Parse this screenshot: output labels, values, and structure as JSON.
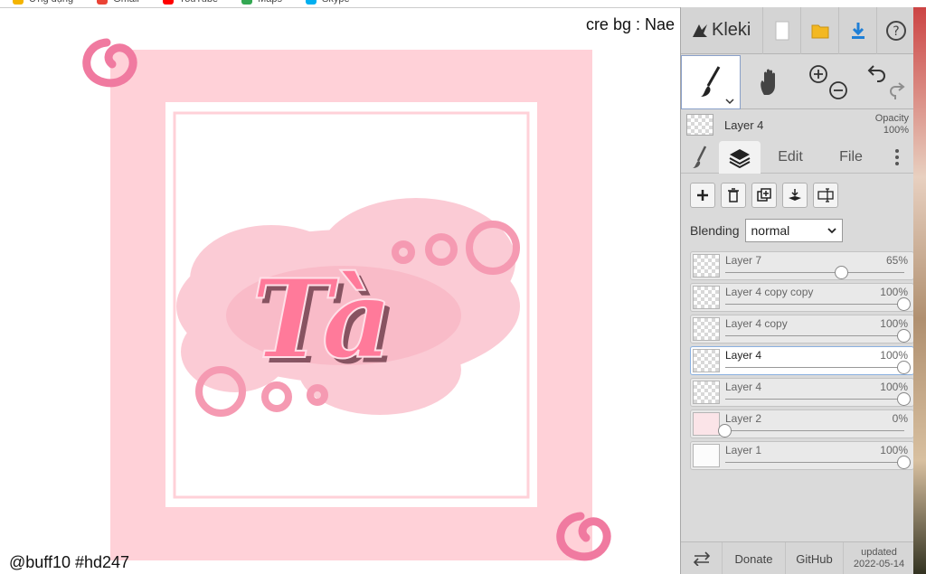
{
  "bookmarks": [
    {
      "label": "Ứng dụng",
      "color": "#f4b400"
    },
    {
      "label": "Gmail",
      "color": "#ea4335"
    },
    {
      "label": "YouTube",
      "color": "#ff0000"
    },
    {
      "label": "Maps",
      "color": "#34a853"
    },
    {
      "label": "Skype",
      "color": "#00aff0"
    }
  ],
  "canvas": {
    "credit_top": "cre bg : Nae",
    "credit_bottom": "@buff10 #hd247",
    "artwork_text": "Tà",
    "colors": {
      "frame": "#ffd1d8",
      "accent": "#ff6f93",
      "swirl": "#f07aa0",
      "bubble": "#f59ab2"
    }
  },
  "app": {
    "name": "Kleki"
  },
  "top_buttons": {
    "new": "new-image-icon",
    "open": "folder-icon",
    "save": "download-icon",
    "help": "help-icon"
  },
  "preview": {
    "layer_name": "Layer 4",
    "opacity_label": "Opacity",
    "opacity_value": "100%"
  },
  "tabs": {
    "edit": "Edit",
    "file": "File"
  },
  "blending": {
    "label": "Blending",
    "value": "normal"
  },
  "layers": [
    {
      "name": "Layer 7",
      "opacity": "65%",
      "level": 0.65,
      "thumb": "checker",
      "selected": false
    },
    {
      "name": "Layer 4 copy copy",
      "opacity": "100%",
      "level": 1.0,
      "thumb": "checker",
      "selected": false
    },
    {
      "name": "Layer 4 copy",
      "opacity": "100%",
      "level": 1.0,
      "thumb": "checker",
      "selected": false
    },
    {
      "name": "Layer 4",
      "opacity": "100%",
      "level": 1.0,
      "thumb": "checker",
      "selected": true
    },
    {
      "name": "Layer 4",
      "opacity": "100%",
      "level": 1.0,
      "thumb": "checker",
      "selected": false
    },
    {
      "name": "Layer 2",
      "opacity": "0%",
      "level": 0.0,
      "thumb": "pinkish",
      "selected": false
    },
    {
      "name": "Layer 1",
      "opacity": "100%",
      "level": 1.0,
      "thumb": "solid",
      "selected": false
    }
  ],
  "footer": {
    "donate": "Donate",
    "github": "GitHub",
    "updated_label": "updated",
    "updated_date": "2022-05-14"
  }
}
